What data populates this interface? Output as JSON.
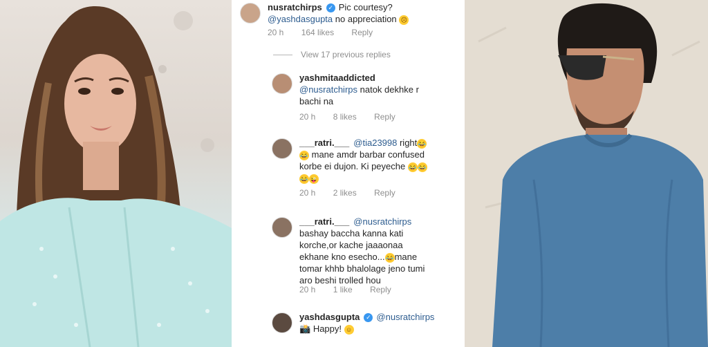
{
  "comments": [
    {
      "username": "nusratchirps",
      "verified": true,
      "text_lines": [
        "Pic courtesy?",
        "@yashdasgupta  no appreciation"
      ],
      "mention": "@yashdasgupta",
      "time": "20 h",
      "likes": "164 likes",
      "reply": "Reply"
    }
  ],
  "view_replies": "View 17 previous replies",
  "replies": [
    {
      "username": "yashmitaaddicted",
      "mention": "@nusratchirps",
      "text_after_mention": " natok dekhke r",
      "text_lines": [
        "bachi na"
      ],
      "time": "20 h",
      "likes": "8 likes",
      "reply": "Reply"
    },
    {
      "username": "___ratri.___",
      "mention": "@tia23998",
      "text_after_mention": " right",
      "text_lines": [
        "mane amdr barbar confused",
        "korbe ei dujon. Ki peyeche",
        ""
      ],
      "time": "20 h",
      "likes": "2 likes",
      "reply": "Reply"
    },
    {
      "username": "___ratri.___",
      "mention": "@nusratchirps",
      "text_lines": [
        "bashay baccha kanna kati",
        "korche,or kache jaaaonaa",
        "ekhane kno esecho...",
        "tomar khhb bhalolage jeno tumi",
        "aro beshi trolled hou"
      ],
      "inline_after_line3": "mane",
      "time": "20 h",
      "likes": "1 like",
      "reply": "Reply"
    },
    {
      "username": "yashdasgupta",
      "verified": true,
      "mention": "@nusratchirps",
      "text_lines": [
        "Happy!"
      ]
    }
  ]
}
